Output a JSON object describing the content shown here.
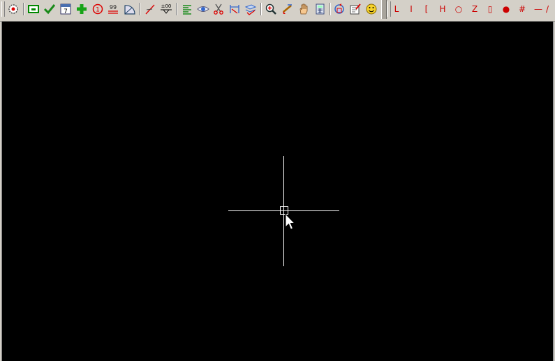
{
  "toolbar_left": {
    "buttons": [
      {
        "name": "settings-gear-icon",
        "title": "settings"
      },
      {
        "name": "rectangle-select-icon",
        "title": "select"
      },
      {
        "name": "checkmark-icon",
        "title": "confirm"
      },
      {
        "name": "calendar-icon",
        "title": "date",
        "text": "7"
      },
      {
        "name": "plus-icon",
        "title": "add"
      },
      {
        "name": "circled-one-icon",
        "title": "number",
        "text": "1"
      },
      {
        "name": "nn-label-icon",
        "title": "label",
        "text": "99"
      },
      {
        "name": "protractor-icon",
        "title": "angle"
      },
      {
        "name": "pen-line-icon",
        "title": "draw"
      },
      {
        "name": "elevation-icon",
        "title": "elevation",
        "text": "±00"
      },
      {
        "name": "align-left-icon",
        "title": "align"
      },
      {
        "name": "eye-icon",
        "title": "view"
      },
      {
        "name": "scissors-icon",
        "title": "cut"
      },
      {
        "name": "dimension-icon",
        "title": "dimension"
      },
      {
        "name": "layers-check-icon",
        "title": "layers"
      },
      {
        "name": "zoom-in-icon",
        "title": "zoom"
      },
      {
        "name": "paint-brush-icon",
        "title": "paint"
      },
      {
        "name": "hand-pan-icon",
        "title": "pan"
      },
      {
        "name": "calculator-icon",
        "title": "calculator"
      },
      {
        "name": "rotate-icon",
        "title": "rotate"
      },
      {
        "name": "book-edit-icon",
        "title": "edit"
      },
      {
        "name": "smiley-icon",
        "title": "smiley"
      }
    ]
  },
  "toolbar_right": {
    "color": "#cc0000",
    "glyphs": [
      "L",
      "I",
      "[",
      "H",
      "○",
      "Z",
      "▯",
      "●",
      "#",
      "—",
      "/"
    ]
  },
  "canvas": {
    "background": "#000000",
    "crosshair_color": "#ffffff"
  }
}
